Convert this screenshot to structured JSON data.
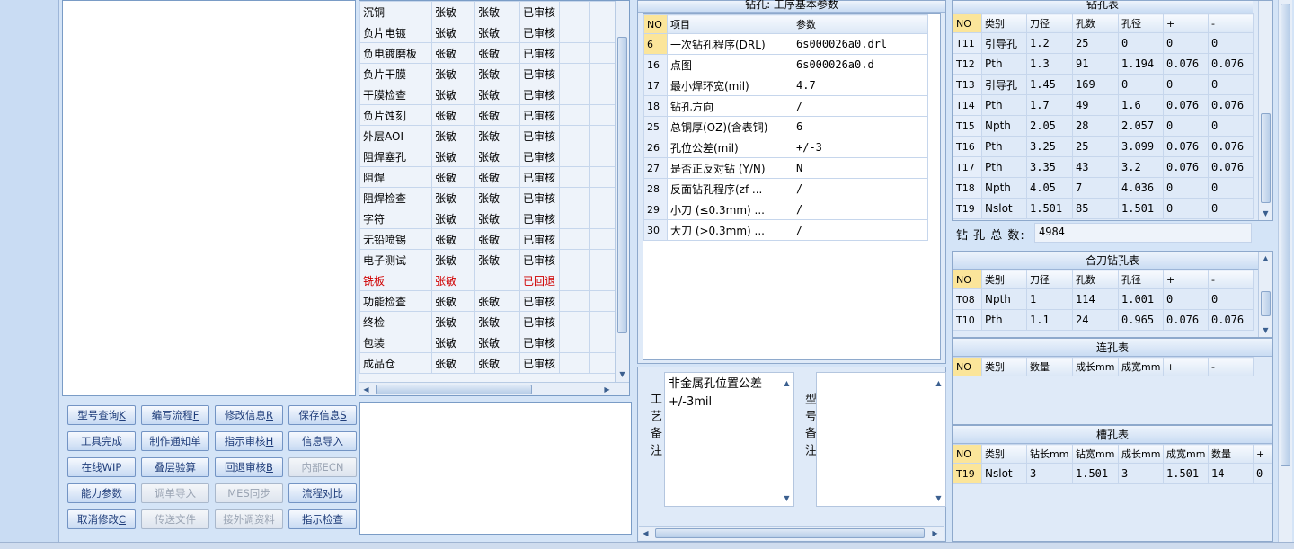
{
  "process_list": {
    "rows": [
      {
        "name": "沉铜",
        "p1": "张敏",
        "p2": "张敏",
        "status": "已审核",
        "red": false
      },
      {
        "name": "负片电镀",
        "p1": "张敏",
        "p2": "张敏",
        "status": "已审核",
        "red": false
      },
      {
        "name": "负电镀磨板",
        "p1": "张敏",
        "p2": "张敏",
        "status": "已审核",
        "red": false
      },
      {
        "name": "负片干膜",
        "p1": "张敏",
        "p2": "张敏",
        "status": "已审核",
        "red": false
      },
      {
        "name": "干膜检查",
        "p1": "张敏",
        "p2": "张敏",
        "status": "已审核",
        "red": false
      },
      {
        "name": "负片蚀刻",
        "p1": "张敏",
        "p2": "张敏",
        "status": "已审核",
        "red": false
      },
      {
        "name": "外层AOI",
        "p1": "张敏",
        "p2": "张敏",
        "status": "已审核",
        "red": false
      },
      {
        "name": "阻焊塞孔",
        "p1": "张敏",
        "p2": "张敏",
        "status": "已审核",
        "red": false
      },
      {
        "name": "阻焊",
        "p1": "张敏",
        "p2": "张敏",
        "status": "已审核",
        "red": false
      },
      {
        "name": "阻焊检查",
        "p1": "张敏",
        "p2": "张敏",
        "status": "已审核",
        "red": false
      },
      {
        "name": "字符",
        "p1": "张敏",
        "p2": "张敏",
        "status": "已审核",
        "red": false
      },
      {
        "name": "无铅喷锡",
        "p1": "张敏",
        "p2": "张敏",
        "status": "已审核",
        "red": false
      },
      {
        "name": "电子测试",
        "p1": "张敏",
        "p2": "张敏",
        "status": "已审核",
        "red": false
      },
      {
        "name": "铣板",
        "p1": "张敏",
        "p2": "",
        "status": "已回退",
        "red": true
      },
      {
        "name": "功能检查",
        "p1": "张敏",
        "p2": "张敏",
        "status": "已审核",
        "red": false
      },
      {
        "name": "终检",
        "p1": "张敏",
        "p2": "张敏",
        "status": "已审核",
        "red": false
      },
      {
        "name": "包装",
        "p1": "张敏",
        "p2": "张敏",
        "status": "已审核",
        "red": false
      },
      {
        "name": "成品仓",
        "p1": "张敏",
        "p2": "张敏",
        "status": "已审核",
        "red": false
      }
    ]
  },
  "buttons": [
    {
      "label": "型号查询",
      "key": "K",
      "disabled": false
    },
    {
      "label": "编写流程",
      "key": "F",
      "disabled": false
    },
    {
      "label": "修改信息",
      "key": "R",
      "disabled": false
    },
    {
      "label": "保存信息",
      "key": "S",
      "disabled": false
    },
    {
      "label": "工具完成",
      "key": "",
      "disabled": false
    },
    {
      "label": "制作通知单",
      "key": "",
      "disabled": false
    },
    {
      "label": "指示审核",
      "key": "H",
      "disabled": false
    },
    {
      "label": "信息导入",
      "key": "",
      "disabled": false
    },
    {
      "label": "在线WIP",
      "key": "",
      "disabled": false
    },
    {
      "label": "叠层验算",
      "key": "",
      "disabled": false
    },
    {
      "label": "回退审核",
      "key": "B",
      "disabled": false
    },
    {
      "label": "内部ECN",
      "key": "",
      "disabled": true
    },
    {
      "label": "能力参数",
      "key": "",
      "disabled": false
    },
    {
      "label": "调单导入",
      "key": "",
      "disabled": true
    },
    {
      "label": "MES同步",
      "key": "",
      "disabled": true
    },
    {
      "label": "流程对比",
      "key": "",
      "disabled": false
    },
    {
      "label": "取消修改",
      "key": "C",
      "disabled": false
    },
    {
      "label": "传送文件",
      "key": "",
      "disabled": true
    },
    {
      "label": "接外调资料",
      "key": "",
      "disabled": true
    },
    {
      "label": "指示检查",
      "key": "",
      "disabled": false
    }
  ],
  "params": {
    "title": "钻孔: 工序基本参数",
    "headers": {
      "no": "NO",
      "item": "项目",
      "value": "参数"
    },
    "rows": [
      {
        "no": "6",
        "item": "一次钻孔程序(DRL)",
        "value": "6s000026a0.drl",
        "selected": true
      },
      {
        "no": "16",
        "item": "点图",
        "value": "6s000026a0.d",
        "selected": false
      },
      {
        "no": "17",
        "item": "最小焊环宽(mil)",
        "value": "4.7",
        "selected": false
      },
      {
        "no": "18",
        "item": "钻孔方向",
        "value": "/",
        "selected": false
      },
      {
        "no": "25",
        "item": "总铜厚(OZ)(含表铜)",
        "value": "6",
        "selected": false
      },
      {
        "no": "26",
        "item": "孔位公差(mil)",
        "value": "+/-3",
        "selected": false
      },
      {
        "no": "27",
        "item": "是否正反对钻 (Y/N)",
        "value": "N",
        "selected": false
      },
      {
        "no": "28",
        "item": "反面钻孔程序(zf-...",
        "value": "/",
        "selected": false
      },
      {
        "no": "29",
        "item": "小刀 (≤0.3mm) ...",
        "value": "/",
        "selected": false
      },
      {
        "no": "30",
        "item": "大刀 (>0.3mm) ...",
        "value": "/",
        "selected": false
      }
    ]
  },
  "remarks": {
    "process_label": "工艺备注",
    "process_text": "非金属孔位置公差+/-3mil",
    "model_label": "型号备注",
    "model_text": ""
  },
  "drill_table": {
    "title": "钻孔表",
    "headers": [
      "NO",
      "类别",
      "刀径",
      "孔数",
      "孔径",
      "+",
      "-"
    ],
    "rows": [
      [
        "T11",
        "引导孔",
        "1.2",
        "25",
        "0",
        "0",
        "0"
      ],
      [
        "T12",
        "Pth",
        "1.3",
        "91",
        "1.194",
        "0.076",
        "0.076"
      ],
      [
        "T13",
        "引导孔",
        "1.45",
        "169",
        "0",
        "0",
        "0"
      ],
      [
        "T14",
        "Pth",
        "1.7",
        "49",
        "1.6",
        "0.076",
        "0.076"
      ],
      [
        "T15",
        "Npth",
        "2.05",
        "28",
        "2.057",
        "0",
        "0"
      ],
      [
        "T16",
        "Pth",
        "3.25",
        "25",
        "3.099",
        "0.076",
        "0.076"
      ],
      [
        "T17",
        "Pth",
        "3.35",
        "43",
        "3.2",
        "0.076",
        "0.076"
      ],
      [
        "T18",
        "Npth",
        "4.05",
        "7",
        "4.036",
        "0",
        "0"
      ],
      [
        "T19",
        "Nslot",
        "1.501",
        "85",
        "1.501",
        "0",
        "0"
      ]
    ],
    "total_label": "钻 孔 总 数:",
    "total_value": "4984"
  },
  "combo_table": {
    "title": "合刀钻孔表",
    "headers": [
      "NO",
      "类别",
      "刀径",
      "孔数",
      "孔径",
      "+",
      "-"
    ],
    "rows": [
      [
        "T08",
        "Npth",
        "1",
        "114",
        "1.001",
        "0",
        "0"
      ],
      [
        "T10",
        "Pth",
        "1.1",
        "24",
        "0.965",
        "0.076",
        "0.076"
      ]
    ]
  },
  "connect_table": {
    "title": "连孔表",
    "headers": [
      "NO",
      "类别",
      "数量",
      "成长mm",
      "成宽mm",
      "+",
      "-"
    ]
  },
  "slot_table": {
    "title": "槽孔表",
    "headers": [
      "NO",
      "类别",
      "钻长mm",
      "钻宽mm",
      "成长mm",
      "成宽mm",
      "数量",
      "+"
    ],
    "rows": [
      [
        "T19",
        "Nslot",
        "3",
        "1.501",
        "3",
        "1.501",
        "14",
        "0"
      ]
    ]
  }
}
